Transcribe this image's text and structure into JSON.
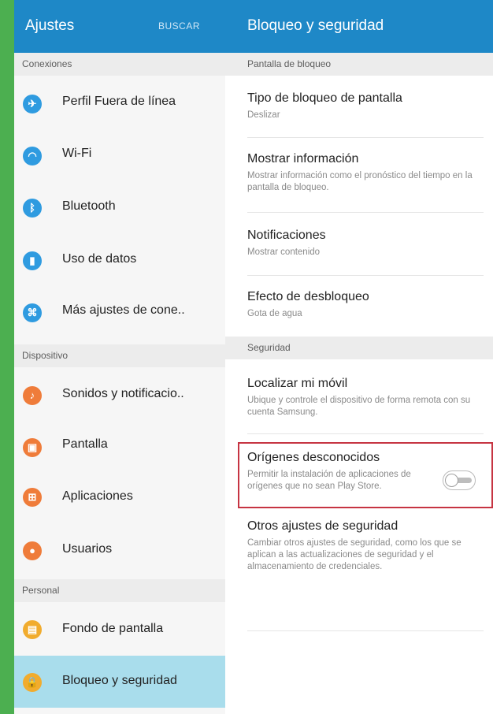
{
  "header": {
    "left_title": "Ajustes",
    "search_label": "BUSCAR",
    "right_title": "Bloqueo y seguridad"
  },
  "sidebar": {
    "sections": [
      {
        "title": "Conexiones",
        "items": [
          {
            "label": "Perfil Fuera de línea",
            "icon": "airplane-icon",
            "color": "#2f9be0"
          },
          {
            "label": "Wi-Fi",
            "icon": "wifi-icon",
            "color": "#2f9be0"
          },
          {
            "label": "Bluetooth",
            "icon": "bluetooth-icon",
            "color": "#2f9be0"
          },
          {
            "label": "Uso de datos",
            "icon": "data-usage-icon",
            "color": "#2f9be0"
          },
          {
            "label": "Más ajustes de cone..",
            "icon": "more-connections-icon",
            "color": "#2f9be0"
          }
        ]
      },
      {
        "title": "Dispositivo",
        "items": [
          {
            "label": "Sonidos y notificacio..",
            "icon": "sound-icon",
            "color": "#ef7c3a"
          },
          {
            "label": "Pantalla",
            "icon": "display-icon",
            "color": "#ef7c3a"
          },
          {
            "label": "Aplicaciones",
            "icon": "apps-icon",
            "color": "#ef7c3a"
          },
          {
            "label": "Usuarios",
            "icon": "users-icon",
            "color": "#ef7c3a"
          }
        ]
      },
      {
        "title": "Personal",
        "items": [
          {
            "label": "Fondo de pantalla",
            "icon": "wallpaper-icon",
            "color": "#f1ac2e"
          },
          {
            "label": "Bloqueo y seguridad",
            "icon": "lock-icon",
            "color": "#f1ac2e",
            "selected": true
          }
        ]
      }
    ]
  },
  "main": {
    "lock_section": {
      "title": "Pantalla de bloqueo",
      "items": [
        {
          "title": "Tipo de bloqueo de pantalla",
          "description": "Deslizar"
        },
        {
          "title": "Mostrar información",
          "description": "Mostrar información como el pronóstico del tiempo en la pantalla de bloqueo."
        },
        {
          "title": "Notificaciones",
          "description": "Mostrar contenido"
        },
        {
          "title": "Efecto de desbloqueo",
          "description": "Gota de agua"
        }
      ]
    },
    "security_section": {
      "title": "Seguridad",
      "items": [
        {
          "title": "Localizar mi móvil",
          "description": "Ubique y controle el dispositivo de forma remota con su cuenta Samsung."
        },
        {
          "title": "Orígenes desconocidos",
          "description": "Permitir la instalación de aplicaciones de orígenes que no sean Play Store.",
          "toggle": "off"
        },
        {
          "title": "Otros ajustes de seguridad",
          "description": "Cambiar otros ajustes de seguridad, como los que se aplican a las actualizaciones de seguridad y el almacenamiento de credenciales."
        }
      ]
    }
  },
  "colors": {
    "header": "#1e88c7",
    "selected_item": "#a9ddec",
    "highlight_border": "#c63442",
    "background": "#4caf50"
  }
}
